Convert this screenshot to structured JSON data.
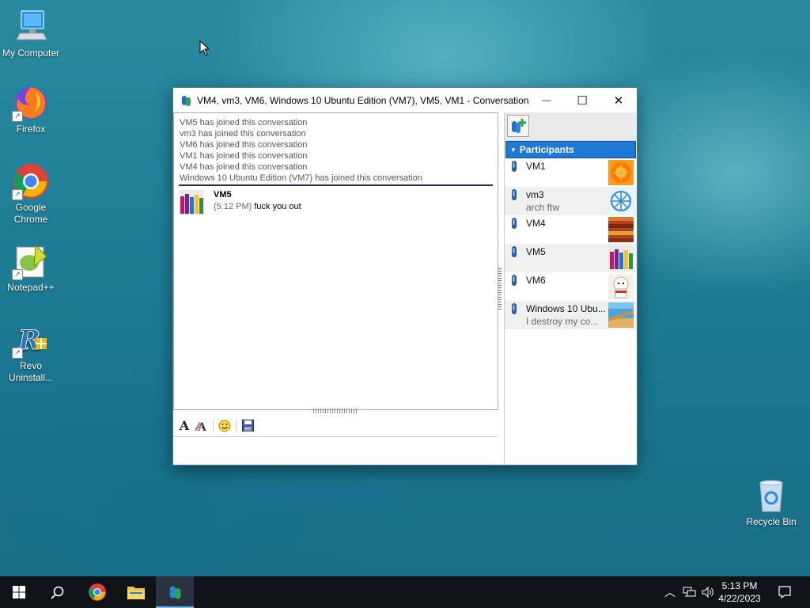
{
  "desktop": {
    "icons": [
      {
        "label": "My Computer"
      },
      {
        "label": "Firefox"
      },
      {
        "label": "Google Chrome"
      },
      {
        "label": "Notepad++"
      },
      {
        "label": "Revo Uninstall..."
      },
      {
        "label": "Recycle Bin"
      }
    ]
  },
  "window": {
    "title": "VM4, vm3, VM6, Windows 10 Ubuntu Edition (VM7), VM5, VM1 - Conversation",
    "minimize": "—",
    "maximize": "☐",
    "close": "✕"
  },
  "conversation": {
    "system_messages": [
      "VM5 has joined this conversation",
      "vm3 has joined this conversation",
      "VM6 has joined this conversation",
      "VM1 has joined this conversation",
      "VM4 has joined this conversation",
      "Windows 10 Ubuntu Edition (VM7) has joined this conversation"
    ],
    "messages": [
      {
        "sender": "VM5",
        "time": "(5:12 PM)",
        "text": "fuck you out"
      }
    ]
  },
  "participants": {
    "header": "Participants",
    "list": [
      {
        "name": "VM1",
        "status": ""
      },
      {
        "name": "vm3",
        "status": "arch ftw"
      },
      {
        "name": "VM4",
        "status": ""
      },
      {
        "name": "VM5",
        "status": ""
      },
      {
        "name": "VM6",
        "status": ""
      },
      {
        "name": "Windows 10 Ubu...",
        "status": "I destroy my co..."
      }
    ]
  },
  "taskbar": {
    "time": "5:13 PM",
    "date": "4/22/2023"
  },
  "colors": {
    "accent": "#1e78d6",
    "taskbar": "#101418"
  }
}
